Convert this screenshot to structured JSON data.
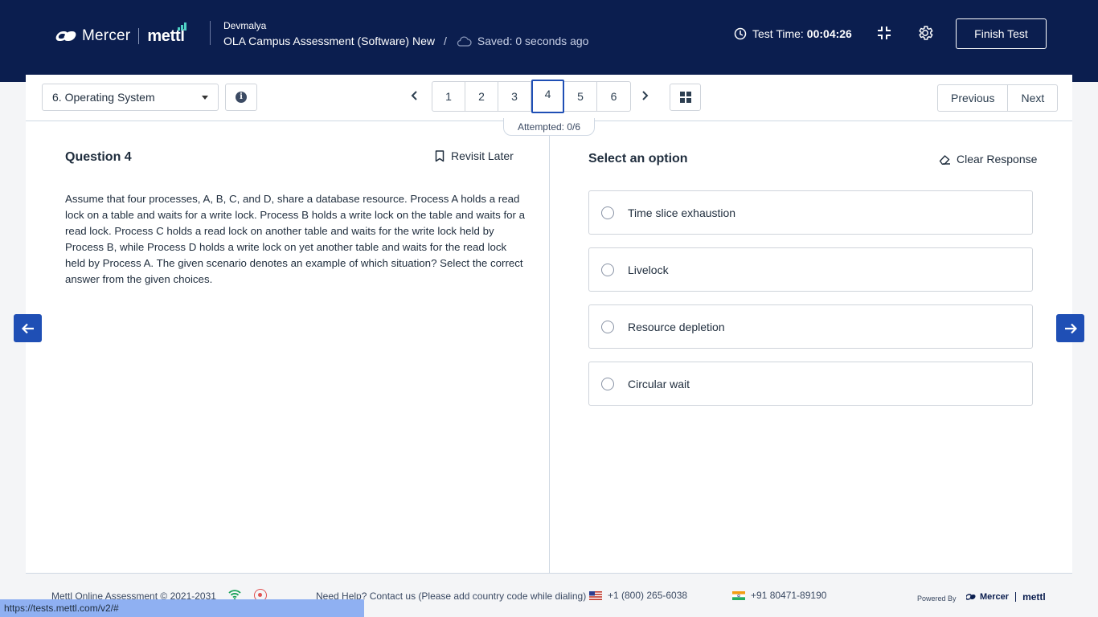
{
  "header": {
    "brand": "Mercer",
    "brand2": "mettl",
    "candidate": "Devmalya",
    "test_name": "OLA Campus Assessment (Software) New",
    "separator": "/",
    "saved": "Saved: 0 seconds ago",
    "timer_label": "Test Time:",
    "timer_value": "00:04:26",
    "finish_label": "Finish Test"
  },
  "toolbar": {
    "section": "6. Operating System",
    "pages": [
      "1",
      "2",
      "3",
      "4",
      "5",
      "6"
    ],
    "active_page": "4",
    "attempted": "Attempted: 0/6",
    "previous_label": "Previous",
    "next_label": "Next"
  },
  "question": {
    "title": "Question 4",
    "revisit_label": "Revisit Later",
    "text": "Assume that four processes, A, B, C, and D, share a database resource. Process A holds a read lock on a table and waits for a write lock. Process B holds a write lock on the table and waits for a read lock. Process C holds a read lock on another table and waits for the write lock held by Process B, while Process D holds a write lock on yet another table and waits for the read lock held by Process A. The given scenario denotes an example of which situation? Select the correct answer from the given choices."
  },
  "answer": {
    "title": "Select an option",
    "clear_label": "Clear Response",
    "options": [
      "Time slice exhaustion",
      "Livelock",
      "Resource depletion",
      "Circular wait"
    ]
  },
  "footer": {
    "copyright": "Mettl Online Assessment © 2021-2031",
    "help": "Need Help? Contact us (Please add country code while dialing)",
    "phone_us": "+1 (800) 265-6038",
    "phone_in": "+91 80471-89190",
    "powered_by": "Powered By",
    "powered_brand": "Mercer",
    "powered_brand2": "mettl"
  },
  "status_bar": {
    "url": "https://tests.mettl.com/v2/#"
  },
  "colors": {
    "header_bg": "#0b1e4f",
    "accent": "#1f4fb5"
  }
}
